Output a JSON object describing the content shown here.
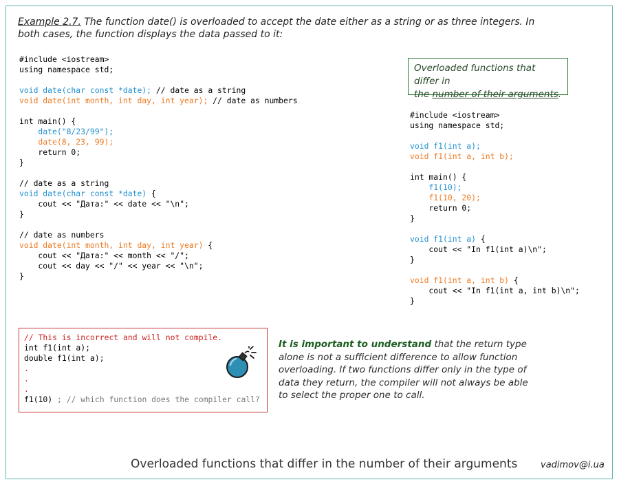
{
  "intro": {
    "example_label": "Example 2.7.",
    "text": " The function date() is overloaded to accept the date either as a string or as three integers. In both cases, the function displays the data passed to it:"
  },
  "left_code": [
    [
      {
        "t": "#include <iostream>",
        "c": ""
      }
    ],
    [
      {
        "t": "using namespace std;",
        "c": ""
      }
    ],
    [],
    [
      {
        "t": "void date(char const *date);",
        "c": "blue"
      },
      {
        "t": " // date as a string",
        "c": ""
      }
    ],
    [
      {
        "t": "void date(int month, int day, int year);",
        "c": "orange"
      },
      {
        "t": " // date as numbers",
        "c": ""
      }
    ],
    [],
    [
      {
        "t": "int main() {",
        "c": ""
      }
    ],
    [
      {
        "t": "    date(\"8/23/99\");",
        "c": "blue"
      }
    ],
    [
      {
        "t": "    date(8, 23, 99);",
        "c": "orange"
      }
    ],
    [
      {
        "t": "    return 0;",
        "c": ""
      }
    ],
    [
      {
        "t": "}",
        "c": ""
      }
    ],
    [],
    [
      {
        "t": "// date as a string",
        "c": ""
      }
    ],
    [
      {
        "t": "void date(char const *date)",
        "c": "blue"
      },
      {
        "t": " {",
        "c": ""
      }
    ],
    [
      {
        "t": "    cout << \"Дата:\" << date << \"\\n\";",
        "c": ""
      }
    ],
    [
      {
        "t": "}",
        "c": ""
      }
    ],
    [],
    [
      {
        "t": "// date as numbers",
        "c": ""
      }
    ],
    [
      {
        "t": "void date(int month, int day, int year)",
        "c": "orange"
      },
      {
        "t": " {",
        "c": ""
      }
    ],
    [
      {
        "t": "    cout << \"Дата:\" << month << \"/\";",
        "c": ""
      }
    ],
    [
      {
        "t": "    cout << day << \"/\" << year << \"\\n\";",
        "c": ""
      }
    ],
    [
      {
        "t": "}",
        "c": ""
      }
    ]
  ],
  "note": {
    "line1": "Overloaded functions that differ in",
    "line2_pre": "the ",
    "line2_underlined": "number of their arguments",
    "line2_post": "."
  },
  "right_code": [
    [
      {
        "t": "#include <iostream>",
        "c": ""
      }
    ],
    [
      {
        "t": "using namespace std;",
        "c": ""
      }
    ],
    [],
    [
      {
        "t": "void f1(int a);",
        "c": "blue"
      }
    ],
    [
      {
        "t": "void f1(int a, int b);",
        "c": "orange"
      }
    ],
    [],
    [
      {
        "t": "int main() {",
        "c": ""
      }
    ],
    [
      {
        "t": "    f1(10);",
        "c": "blue"
      }
    ],
    [
      {
        "t": "    f1(10, 20);",
        "c": "orange"
      }
    ],
    [
      {
        "t": "    return 0;",
        "c": ""
      }
    ],
    [
      {
        "t": "}",
        "c": ""
      }
    ],
    [],
    [
      {
        "t": "void f1(int a)",
        "c": "blue"
      },
      {
        "t": " {",
        "c": ""
      }
    ],
    [
      {
        "t": "    cout << \"In f1(int a)\\n\";",
        "c": ""
      }
    ],
    [
      {
        "t": "}",
        "c": ""
      }
    ],
    [],
    [
      {
        "t": "void f1(int a, int b)",
        "c": "orange"
      },
      {
        "t": " {",
        "c": ""
      }
    ],
    [
      {
        "t": "    cout << \"In f1(int a, int b)\\n\";",
        "c": ""
      }
    ],
    [
      {
        "t": "}",
        "c": ""
      }
    ]
  ],
  "error_code": [
    [
      {
        "t": "// This is incorrect and will not compile.",
        "c": "red"
      }
    ],
    [
      {
        "t": "int f1(int a);",
        "c": ""
      }
    ],
    [
      {
        "t": "double f1(int a);",
        "c": ""
      }
    ],
    [
      {
        "t": ".",
        "c": "red"
      }
    ],
    [
      {
        "t": ".",
        "c": "red"
      }
    ],
    [
      {
        "t": ".",
        "c": "red"
      }
    ],
    [
      {
        "t": "f1(10)",
        "c": ""
      },
      {
        "t": " ; // which function does the compiler call?",
        "c": "gray"
      }
    ]
  ],
  "bomb_icon": "bomb-icon",
  "important": {
    "bold": "It is important to understand",
    "rest": " that the return type alone is not a sufficient difference to allow function overloading.  If two functions differ only in the type of data they return, the compiler will not always be able to select the proper one to call."
  },
  "footer": {
    "title": "Overloaded functions that differ in the number of their arguments",
    "author": "vadimov@i.ua"
  },
  "colors": {
    "blue": "#1f8fcf",
    "orange": "#ee7a22",
    "red": "#cc2222",
    "frame": "#5fb6b5",
    "note_border": "#2e7d32"
  }
}
